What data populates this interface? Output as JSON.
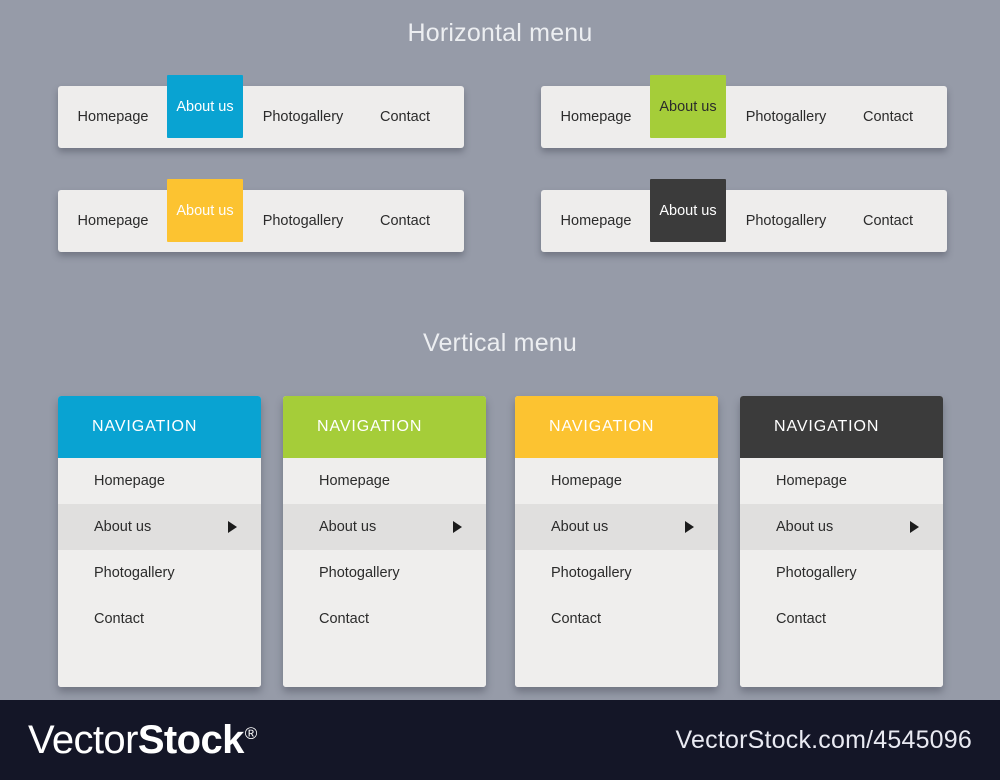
{
  "sections": {
    "horizontal_title": "Horizontal menu",
    "vertical_title": "Vertical menu"
  },
  "colors": {
    "page_background": "#969ba8",
    "bar_background": "#eeedec",
    "card_background": "#efeeed",
    "selected_row": "#e0dfde",
    "blue": "#09a3d2",
    "green": "#a5cd39",
    "yellow": "#fcc331",
    "dark": "#3b3b3b",
    "footer_background": "#141627",
    "heading_text": "#eceef1",
    "item_text": "#2b2b2b"
  },
  "horizontal_menus": [
    {
      "theme": "blue",
      "accent": "#09a3d2",
      "active_text_color": "#ffffff",
      "items": [
        {
          "label": "Homepage",
          "active": false
        },
        {
          "label": "About us",
          "active": true
        },
        {
          "label": "Photogallery",
          "active": false
        },
        {
          "label": "Contact",
          "active": false
        }
      ]
    },
    {
      "theme": "green",
      "accent": "#a5cd39",
      "active_text_color": "#2b2b2b",
      "items": [
        {
          "label": "Homepage",
          "active": false
        },
        {
          "label": "About us",
          "active": true
        },
        {
          "label": "Photogallery",
          "active": false
        },
        {
          "label": "Contact",
          "active": false
        }
      ]
    },
    {
      "theme": "yellow",
      "accent": "#fcc331",
      "active_text_color": "#fdfdfd",
      "items": [
        {
          "label": "Homepage",
          "active": false
        },
        {
          "label": "About us",
          "active": true
        },
        {
          "label": "Photogallery",
          "active": false
        },
        {
          "label": "Contact",
          "active": false
        }
      ]
    },
    {
      "theme": "dark",
      "accent": "#3b3b3b",
      "active_text_color": "#ffffff",
      "items": [
        {
          "label": "Homepage",
          "active": false
        },
        {
          "label": "About us",
          "active": true
        },
        {
          "label": "Photogallery",
          "active": false
        },
        {
          "label": "Contact",
          "active": false
        }
      ]
    }
  ],
  "vertical_menus": [
    {
      "theme": "blue",
      "accent": "#09a3d2",
      "header": "NAVIGATION",
      "items": [
        {
          "label": "Homepage",
          "selected": false,
          "has_submenu": false
        },
        {
          "label": "About us",
          "selected": true,
          "has_submenu": true,
          "icon": "arrow-right-icon"
        },
        {
          "label": "Photogallery",
          "selected": false,
          "has_submenu": false
        },
        {
          "label": "Contact",
          "selected": false,
          "has_submenu": false
        }
      ]
    },
    {
      "theme": "green",
      "accent": "#a5cd39",
      "header": "NAVIGATION",
      "items": [
        {
          "label": "Homepage",
          "selected": false,
          "has_submenu": false
        },
        {
          "label": "About us",
          "selected": true,
          "has_submenu": true,
          "icon": "arrow-right-icon"
        },
        {
          "label": "Photogallery",
          "selected": false,
          "has_submenu": false
        },
        {
          "label": "Contact",
          "selected": false,
          "has_submenu": false
        }
      ]
    },
    {
      "theme": "yellow",
      "accent": "#fcc331",
      "header": "NAVIGATION",
      "items": [
        {
          "label": "Homepage",
          "selected": false,
          "has_submenu": false
        },
        {
          "label": "About us",
          "selected": true,
          "has_submenu": true,
          "icon": "arrow-right-icon"
        },
        {
          "label": "Photogallery",
          "selected": false,
          "has_submenu": false
        },
        {
          "label": "Contact",
          "selected": false,
          "has_submenu": false
        }
      ]
    },
    {
      "theme": "dark",
      "accent": "#3b3b3b",
      "header": "NAVIGATION",
      "items": [
        {
          "label": "Homepage",
          "selected": false,
          "has_submenu": false
        },
        {
          "label": "About us",
          "selected": true,
          "has_submenu": true,
          "icon": "arrow-right-icon"
        },
        {
          "label": "Photogallery",
          "selected": false,
          "has_submenu": false
        },
        {
          "label": "Contact",
          "selected": false,
          "has_submenu": false
        }
      ]
    }
  ],
  "footer": {
    "logo_light": "Vector",
    "logo_bold": "Stock",
    "logo_registered": "®",
    "url": "VectorStock.com/4545096"
  }
}
